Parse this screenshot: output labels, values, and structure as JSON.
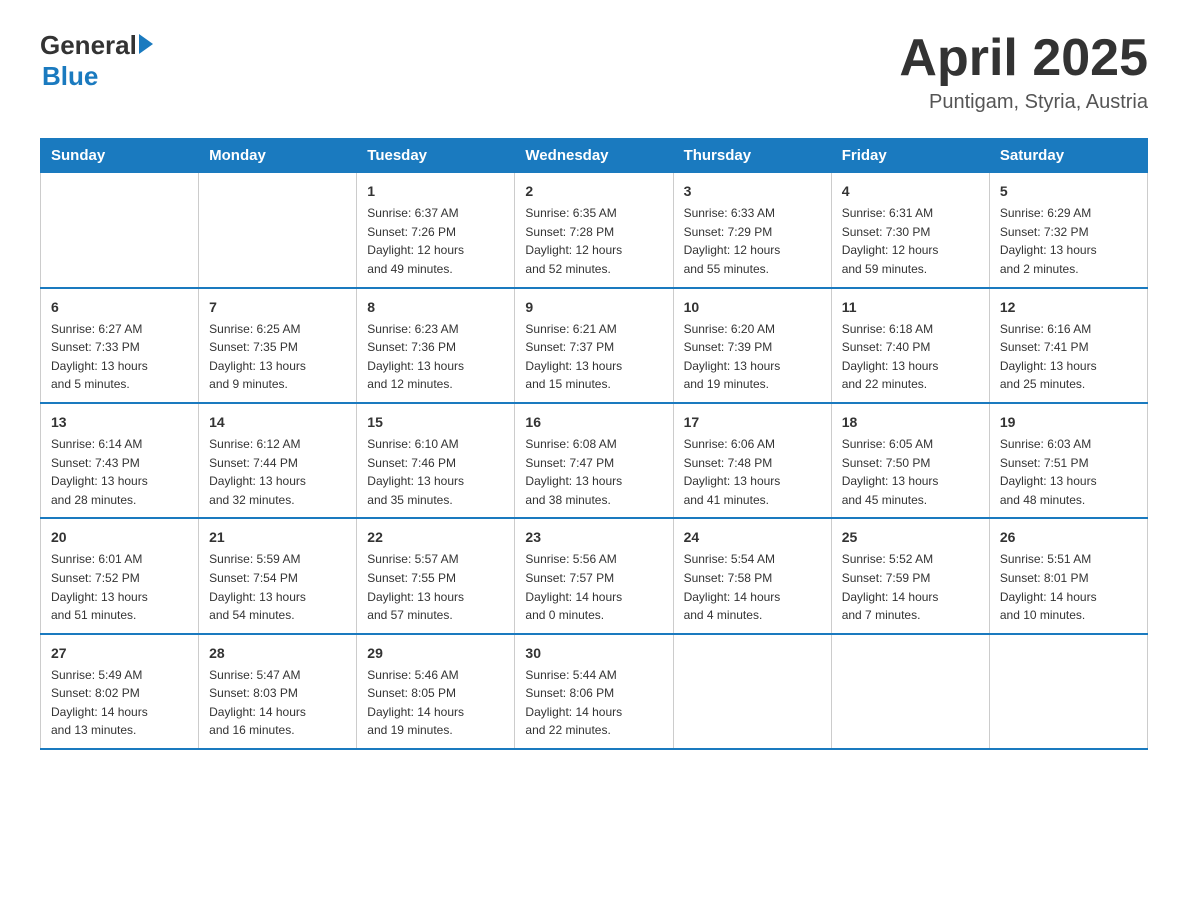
{
  "logo": {
    "general": "General",
    "blue": "Blue"
  },
  "title": {
    "month": "April 2025",
    "location": "Puntigam, Styria, Austria"
  },
  "header_days": [
    "Sunday",
    "Monday",
    "Tuesday",
    "Wednesday",
    "Thursday",
    "Friday",
    "Saturday"
  ],
  "weeks": [
    [
      {
        "day": "",
        "info": ""
      },
      {
        "day": "",
        "info": ""
      },
      {
        "day": "1",
        "info": "Sunrise: 6:37 AM\nSunset: 7:26 PM\nDaylight: 12 hours\nand 49 minutes."
      },
      {
        "day": "2",
        "info": "Sunrise: 6:35 AM\nSunset: 7:28 PM\nDaylight: 12 hours\nand 52 minutes."
      },
      {
        "day": "3",
        "info": "Sunrise: 6:33 AM\nSunset: 7:29 PM\nDaylight: 12 hours\nand 55 minutes."
      },
      {
        "day": "4",
        "info": "Sunrise: 6:31 AM\nSunset: 7:30 PM\nDaylight: 12 hours\nand 59 minutes."
      },
      {
        "day": "5",
        "info": "Sunrise: 6:29 AM\nSunset: 7:32 PM\nDaylight: 13 hours\nand 2 minutes."
      }
    ],
    [
      {
        "day": "6",
        "info": "Sunrise: 6:27 AM\nSunset: 7:33 PM\nDaylight: 13 hours\nand 5 minutes."
      },
      {
        "day": "7",
        "info": "Sunrise: 6:25 AM\nSunset: 7:35 PM\nDaylight: 13 hours\nand 9 minutes."
      },
      {
        "day": "8",
        "info": "Sunrise: 6:23 AM\nSunset: 7:36 PM\nDaylight: 13 hours\nand 12 minutes."
      },
      {
        "day": "9",
        "info": "Sunrise: 6:21 AM\nSunset: 7:37 PM\nDaylight: 13 hours\nand 15 minutes."
      },
      {
        "day": "10",
        "info": "Sunrise: 6:20 AM\nSunset: 7:39 PM\nDaylight: 13 hours\nand 19 minutes."
      },
      {
        "day": "11",
        "info": "Sunrise: 6:18 AM\nSunset: 7:40 PM\nDaylight: 13 hours\nand 22 minutes."
      },
      {
        "day": "12",
        "info": "Sunrise: 6:16 AM\nSunset: 7:41 PM\nDaylight: 13 hours\nand 25 minutes."
      }
    ],
    [
      {
        "day": "13",
        "info": "Sunrise: 6:14 AM\nSunset: 7:43 PM\nDaylight: 13 hours\nand 28 minutes."
      },
      {
        "day": "14",
        "info": "Sunrise: 6:12 AM\nSunset: 7:44 PM\nDaylight: 13 hours\nand 32 minutes."
      },
      {
        "day": "15",
        "info": "Sunrise: 6:10 AM\nSunset: 7:46 PM\nDaylight: 13 hours\nand 35 minutes."
      },
      {
        "day": "16",
        "info": "Sunrise: 6:08 AM\nSunset: 7:47 PM\nDaylight: 13 hours\nand 38 minutes."
      },
      {
        "day": "17",
        "info": "Sunrise: 6:06 AM\nSunset: 7:48 PM\nDaylight: 13 hours\nand 41 minutes."
      },
      {
        "day": "18",
        "info": "Sunrise: 6:05 AM\nSunset: 7:50 PM\nDaylight: 13 hours\nand 45 minutes."
      },
      {
        "day": "19",
        "info": "Sunrise: 6:03 AM\nSunset: 7:51 PM\nDaylight: 13 hours\nand 48 minutes."
      }
    ],
    [
      {
        "day": "20",
        "info": "Sunrise: 6:01 AM\nSunset: 7:52 PM\nDaylight: 13 hours\nand 51 minutes."
      },
      {
        "day": "21",
        "info": "Sunrise: 5:59 AM\nSunset: 7:54 PM\nDaylight: 13 hours\nand 54 minutes."
      },
      {
        "day": "22",
        "info": "Sunrise: 5:57 AM\nSunset: 7:55 PM\nDaylight: 13 hours\nand 57 minutes."
      },
      {
        "day": "23",
        "info": "Sunrise: 5:56 AM\nSunset: 7:57 PM\nDaylight: 14 hours\nand 0 minutes."
      },
      {
        "day": "24",
        "info": "Sunrise: 5:54 AM\nSunset: 7:58 PM\nDaylight: 14 hours\nand 4 minutes."
      },
      {
        "day": "25",
        "info": "Sunrise: 5:52 AM\nSunset: 7:59 PM\nDaylight: 14 hours\nand 7 minutes."
      },
      {
        "day": "26",
        "info": "Sunrise: 5:51 AM\nSunset: 8:01 PM\nDaylight: 14 hours\nand 10 minutes."
      }
    ],
    [
      {
        "day": "27",
        "info": "Sunrise: 5:49 AM\nSunset: 8:02 PM\nDaylight: 14 hours\nand 13 minutes."
      },
      {
        "day": "28",
        "info": "Sunrise: 5:47 AM\nSunset: 8:03 PM\nDaylight: 14 hours\nand 16 minutes."
      },
      {
        "day": "29",
        "info": "Sunrise: 5:46 AM\nSunset: 8:05 PM\nDaylight: 14 hours\nand 19 minutes."
      },
      {
        "day": "30",
        "info": "Sunrise: 5:44 AM\nSunset: 8:06 PM\nDaylight: 14 hours\nand 22 minutes."
      },
      {
        "day": "",
        "info": ""
      },
      {
        "day": "",
        "info": ""
      },
      {
        "day": "",
        "info": ""
      }
    ]
  ]
}
